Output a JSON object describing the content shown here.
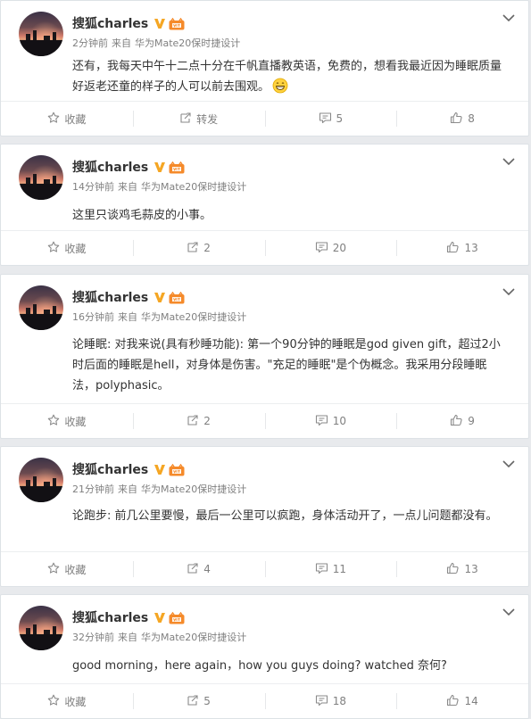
{
  "posts": [
    {
      "author": "搜狐charles",
      "time": "2分钟前",
      "source_prefix": "来自",
      "source": "华为Mate20保时捷设计",
      "content": "还有，我每天中午十二点十分在千帆直播教英语，免费的，想看我最近因为睡眠质量好返老还童的样子的人可以前去围观。",
      "emoji": "grinning-face",
      "actions": {
        "favorite": "收藏",
        "repost": "转发",
        "comment": "5",
        "like": "8"
      }
    },
    {
      "author": "搜狐charles",
      "time": "14分钟前",
      "source_prefix": "来自",
      "source": "华为Mate20保时捷设计",
      "content": "这里只谈鸡毛蒜皮的小事。",
      "actions": {
        "favorite": "收藏",
        "repost": "2",
        "comment": "20",
        "like": "13"
      }
    },
    {
      "author": "搜狐charles",
      "time": "16分钟前",
      "source_prefix": "来自",
      "source": "华为Mate20保时捷设计",
      "content": "论睡眠: 对我来说(具有秒睡功能): 第一个90分钟的睡眠是god given gift，超过2小时后面的睡眠是hell，对身体是伤害。\"充足的睡眠\"是个伪概念。我采用分段睡眠法，polyphasic。",
      "actions": {
        "favorite": "收藏",
        "repost": "2",
        "comment": "10",
        "like": "9"
      }
    },
    {
      "author": "搜狐charles",
      "time": "21分钟前",
      "source_prefix": "来自",
      "source": "华为Mate20保时捷设计",
      "content": "论跑步: 前几公里要慢，最后一公里可以疯跑，身体活动开了，一点儿问题都没有。",
      "actions": {
        "favorite": "收藏",
        "repost": "4",
        "comment": "11",
        "like": "13"
      }
    },
    {
      "author": "搜狐charles",
      "time": "32分钟前",
      "source_prefix": "来自",
      "source": "华为Mate20保时捷设计",
      "content": "good morning，here again，how you guys doing? watched 奈何?",
      "actions": {
        "favorite": "收藏",
        "repost": "5",
        "comment": "18",
        "like": "14"
      }
    }
  ],
  "colors": {
    "background": "#e8eaed",
    "verified_badge": "#f5a623",
    "member_badge": "#f58a2a",
    "meta_text": "#808080"
  },
  "icons": {
    "favorite": "star-icon",
    "repost": "repost-icon",
    "comment": "comment-icon",
    "like": "thumbs-up-icon",
    "menu": "chevron-down-icon",
    "verified": "verified-v-icon",
    "member": "member-crown-icon"
  }
}
